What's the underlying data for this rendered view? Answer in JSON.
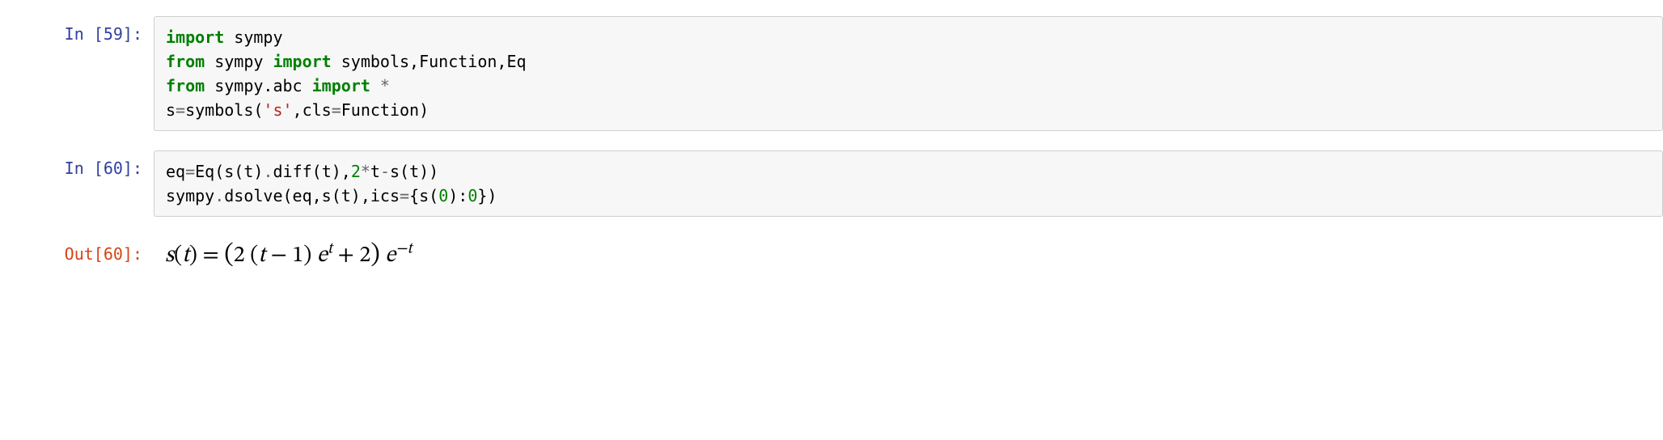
{
  "cells": {
    "c59": {
      "prompt_label": "In [59]:",
      "code": {
        "l1": {
          "kw": "import",
          "module": " sympy"
        },
        "l2": {
          "kw1": "from",
          "mod": " sympy ",
          "kw2": "import",
          "names": " symbols,Function,Eq"
        },
        "l3": {
          "kw1": "from",
          "mod": " sympy.abc ",
          "kw2": "import",
          "star": " *"
        },
        "l4": {
          "lead": "s",
          "eq": "=",
          "fn": "symbols(",
          "str": "'s'",
          "rest": ",cls",
          "eq2": "=",
          "tail": "Function)"
        }
      }
    },
    "c60": {
      "prompt_label": "In [60]:",
      "code": {
        "l1": {
          "a": "eq",
          "eq": "=",
          "b": "Eq(s(t)",
          "dot": ".",
          "c": "diff(t),",
          "n": "2",
          "star": "*",
          "d": "t",
          "minus": "-",
          "e": "s(t))"
        },
        "l2": {
          "a": "sympy",
          "dot": ".",
          "b": "dsolve(eq,s(t),ics",
          "eq": "=",
          "c": "{s(",
          "n0": "0",
          "d": "):",
          "n1": "0",
          "e": "})"
        }
      }
    },
    "out60": {
      "prompt_label": "Out[60]:",
      "math": {
        "fn": "s",
        "open1": "(",
        "var1": "t",
        "close1": ")",
        "eqsym": " = ",
        "open2": "(",
        "two1": "2",
        "space1": " ",
        "open3": "(",
        "var2": "t",
        "minus": " − ",
        "one": "1",
        "close3": ")",
        "space2": " ",
        "e1": "e",
        "sup1": "t",
        "plus": " + ",
        "two2": "2",
        "close2": ")",
        "space3": " ",
        "e2": "e",
        "sup2": "−t"
      }
    }
  }
}
